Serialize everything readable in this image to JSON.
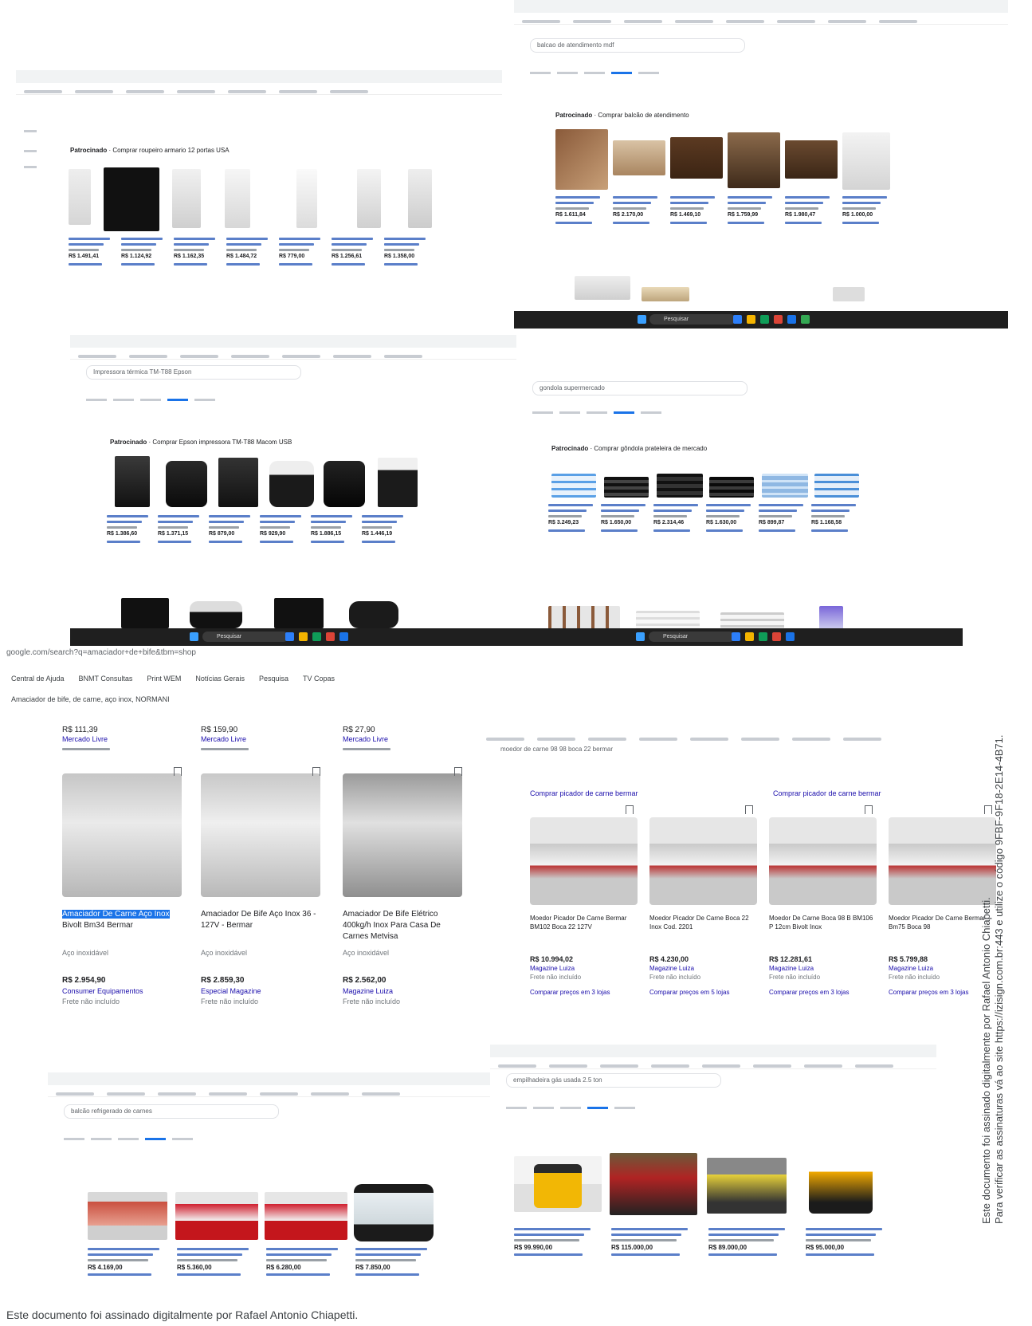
{
  "signature": {
    "side_line1": "Este documento foi assinado digitalmente por Rafael Antonio Chiapetti.",
    "side_line2": "Para verificar as assinaturas vá ao site https://izisign.com.br:443 e utilize o código 9FBF-9F18-2E14-4B71.",
    "footer": "Este documento foi assinado digitalmente por Rafael Antonio Chiapetti."
  },
  "panels": {
    "armario": {
      "sponsored_label": "Patrocinado",
      "sponsored_title": "Comprar roupeiro armario 12 portas USA",
      "prices": [
        "R$ 1.491,41",
        "R$ 1.124,92",
        "R$ 1.162,35",
        "R$ 1.484,72",
        "R$ 779,00",
        "R$ 1.256,61",
        "R$ 1.358,00"
      ]
    },
    "moveis": {
      "sponsored_label": "Patrocinado",
      "sponsored_title": "Comprar balcão de atendimento",
      "search": "balcao de atendimento mdf",
      "prices": [
        "R$ 1.611,84",
        "R$ 2.170,00",
        "R$ 1.469,10",
        "R$ 1.759,99",
        "R$ 1.980,47",
        "R$ 1.000,00"
      ],
      "tb_search": "Pesquisar"
    },
    "impressora": {
      "sponsored_label": "Patrocinado",
      "sponsored_title": "Comprar Epson impressora TM-T88 Macom USB",
      "search": "Impressora térmica TM-T88 Epson",
      "prices": [
        "R$ 1.386,60",
        "R$ 1.371,15",
        "R$ 879,00",
        "R$ 929,90",
        "R$ 1.886,15",
        "R$ 1.446,19"
      ],
      "tb_search": "Pesquisar"
    },
    "gondola": {
      "sponsored_label": "Patrocinado",
      "sponsored_title": "Comprar gôndola prateleira de mercado",
      "search": "gondola supermercado",
      "prices": [
        "R$ 3.249,23",
        "R$ 1.650,00",
        "R$ 2.314,46",
        "R$ 1.630,00",
        "R$ 899,87",
        "R$ 1.168,58"
      ],
      "tb_search": "Pesquisar"
    },
    "amaciador": {
      "url": "google.com/search?q=amaciador+de+bife&tbm=shop",
      "search": "Amaciador de bife, de carne, aço inox, NORMANI",
      "bookmarks": [
        "Central de Ajuda",
        "BNMT Consultas",
        "Print WEM",
        "Notícias Gerais",
        "Pesquisa",
        "TV Copas"
      ],
      "top_prices": [
        "R$ 111,39",
        "R$ 159,90",
        "R$ 27,90"
      ],
      "top_sellers": [
        "Mercado Livre",
        "Mercado Livre",
        "Mercado Livre"
      ],
      "items": [
        {
          "title_hl": "Amaciador De Carne Aço Inox",
          "title_rest": "Bivolt Bm34 Bermar",
          "meta": "Aço inoxidável",
          "price": "R$ 2.954,90",
          "seller": "Consumer Equipamentos",
          "ship": "Frete não incluído"
        },
        {
          "title_hl": "",
          "title_rest": "Amaciador De Bife Aço Inox 36 - 127V - Bermar",
          "meta": "Aço inoxidável",
          "price": "R$ 2.859,30",
          "seller": "Especial Magazine",
          "ship": "Frete não incluído"
        },
        {
          "title_hl": "",
          "title_rest": "Amaciador De Bife Elétrico 400kg/h Inox Para Casa De Carnes Metvisa",
          "meta": "Aço inoxidável",
          "price": "R$ 2.562,00",
          "seller": "Magazine Luiza",
          "ship": "Frete não incluído"
        }
      ]
    },
    "moedor": {
      "search": "moedor de carne 98 98 boca 22 bermar",
      "header_left": "Comprar picador de carne bermar",
      "header_right": "Comprar picador de carne bermar",
      "items": [
        {
          "title": "Moedor Picador De Carne Bermar BM102 Boca 22 127V",
          "price": "R$ 10.994,02",
          "seller": "Magazine Luiza",
          "ship": "Frete não incluído",
          "compare": "Comparar preços em 3 lojas"
        },
        {
          "title": "Moedor Picador De Carne Boca 22 Inox Cod. 2201",
          "price": "R$ 4.230,00",
          "seller": "Magazine Luiza",
          "ship": "Frete não incluído",
          "compare": "Comparar preços em 5 lojas"
        },
        {
          "title": "Moedor De Carne Boca 98 B BM106 P 12cm Bivolt Inox",
          "price": "R$ 12.281,61",
          "seller": "Magazine Luiza",
          "ship": "Frete não incluído",
          "compare": "Comparar preços em 3 lojas"
        },
        {
          "title": "Moedor Picador De Carne Bermar Bm75 Boca 98",
          "price": "R$ 5.799,88",
          "seller": "Magazine Luiza",
          "ship": "Frete não incluído",
          "compare": "Comparar preços em 3 lojas"
        }
      ]
    },
    "balcao": {
      "search": "balcão refrigerado de carnes",
      "prices": [
        "R$ 4.169,00",
        "R$ 5.360,00",
        "R$ 6.280,00",
        "R$ 7.850,00"
      ]
    },
    "empilhadeira": {
      "search": "empilhadeira gás usada 2.5 ton",
      "prices": [
        "R$ 99.990,00",
        "R$ 115.000,00",
        "R$ 89.000,00",
        "R$ 95.000,00"
      ]
    }
  },
  "colors": {
    "link": "#1a0dab",
    "accent": "#1a73e8",
    "taskbar": "#1f1f1f"
  }
}
